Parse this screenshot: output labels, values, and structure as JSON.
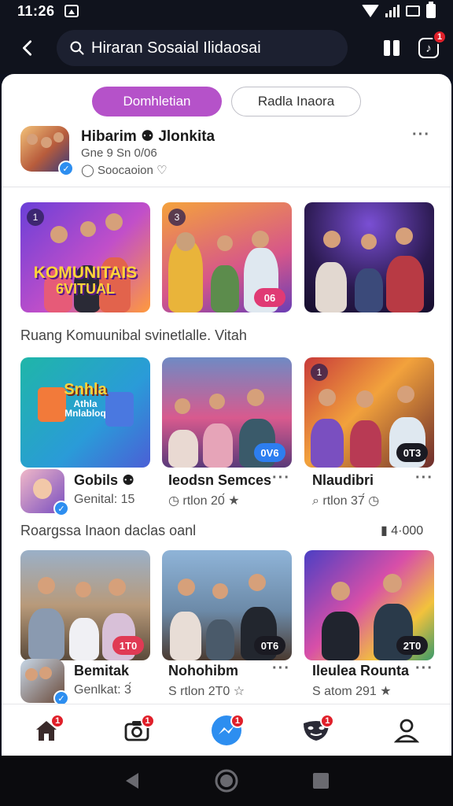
{
  "status_bar": {
    "time": "11:26"
  },
  "app_bar": {
    "search_text": "Hiraran Sosaial Ilidaosai",
    "notification_count": "1"
  },
  "tabs": [
    {
      "label": "Domhletian",
      "active": true
    },
    {
      "label": "Radla Inaora",
      "active": false
    }
  ],
  "profile": {
    "name": "Hibarim ⚉ Jlonkita",
    "line1": "Gne 9 Sn 0/06",
    "line2": "◯ Soocaoion ♡"
  },
  "cards_row1": [
    {
      "badge": "1",
      "poster": "KOMUNITAIS",
      "poster2": "6VITUAL",
      "count": ""
    },
    {
      "badge": "3",
      "count": "06"
    },
    {
      "badge": "",
      "count": ""
    }
  ],
  "section1_label": "Ruang Komuunibal svinetlalle. Vitah",
  "cards_row2": [
    {
      "poster": "Snhla",
      "poster2": "Athla",
      "poster3": "Mnlabloq",
      "count": ""
    },
    {
      "count": "0V6"
    },
    {
      "badge": "1",
      "count": "0T3"
    }
  ],
  "items_row1": [
    {
      "title": "Gobils ⚉",
      "sub": "Genital: 15"
    },
    {
      "title": "Ieodsn Semces",
      "sub": "◷ rtlon 20́ ★"
    },
    {
      "title": "Nlaudibri",
      "sub": "⌕ rtlon 37́ ◷"
    }
  ],
  "section2_label": "Roargssa Inaon daclas oanl",
  "section2_count": "▮ 4·000",
  "cards_row3": [
    {
      "count": "1T0"
    },
    {
      "count": "0T6"
    },
    {
      "count": "2T0"
    }
  ],
  "items_row2": [
    {
      "title": "Bemitak",
      "sub": "Genlkat: 3́"
    },
    {
      "title": "Nohohibm",
      "sub": "S rtlon 2T0 ☆"
    },
    {
      "title": "Ileulea Rounta",
      "sub": "S atom 291 ★"
    }
  ],
  "bottom_nav": [
    {
      "name": "home",
      "badge": "1"
    },
    {
      "name": "camera",
      "badge": "1"
    },
    {
      "name": "messenger",
      "badge": "1"
    },
    {
      "name": "masks",
      "badge": "1"
    },
    {
      "name": "profile",
      "badge": ""
    }
  ],
  "colors": {
    "accent": "#b552c9",
    "badge": "#e0202a",
    "verified": "#2d8ef0",
    "count_pink": "#e03a74",
    "count_blue": "#2d7ef0"
  }
}
